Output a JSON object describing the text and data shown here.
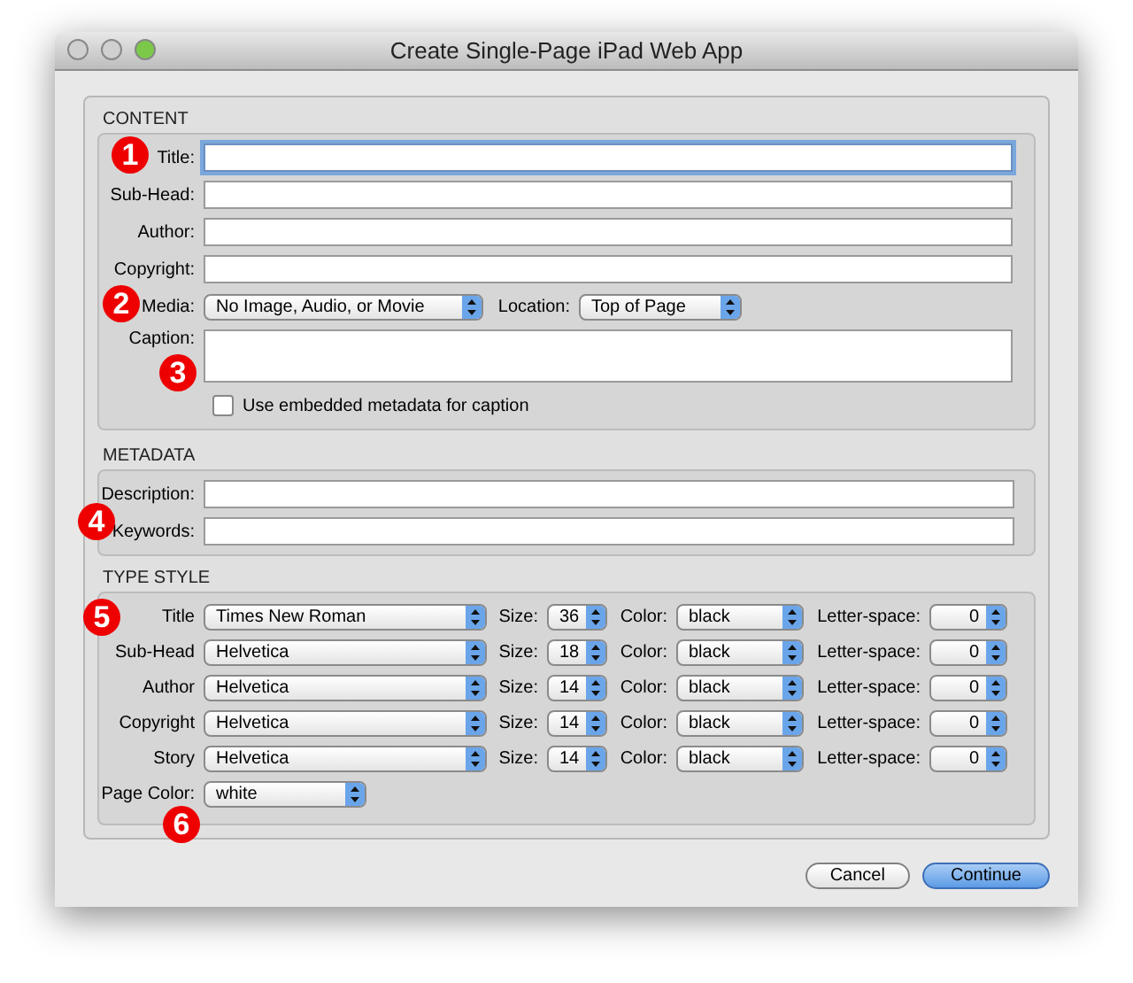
{
  "window": {
    "title": "Create Single-Page iPad Web App"
  },
  "content": {
    "heading": "CONTENT",
    "fields": [
      {
        "label": "Title:",
        "focused": true
      },
      {
        "label": "Sub-Head:",
        "focused": false
      },
      {
        "label": "Author:",
        "focused": false
      },
      {
        "label": "Copyright:",
        "focused": false
      }
    ],
    "media": {
      "label": "Media:",
      "value": "No Image, Audio, or Movie"
    },
    "location": {
      "label": "Location:",
      "value": "Top of Page"
    },
    "caption": {
      "label": "Caption:"
    },
    "metadata_checkbox": {
      "label": "Use embedded metadata for caption",
      "checked": false
    }
  },
  "metadata": {
    "heading": "METADATA",
    "fields": [
      {
        "label": "Description:"
      },
      {
        "label": "Keywords:"
      }
    ]
  },
  "type_style": {
    "heading": "TYPE STYLE",
    "rows": [
      {
        "element": "Title",
        "font": "Times New Roman",
        "size_label": "Size:",
        "size": "36",
        "color_label": "Color:",
        "text_color": "black",
        "spacing_label": "Letter-space:",
        "letter_space": "0"
      },
      {
        "element": "Sub-Head",
        "font": "Helvetica",
        "size_label": "Size:",
        "size": "18",
        "color_label": "Color:",
        "text_color": "black",
        "spacing_label": "Letter-space:",
        "letter_space": "0"
      },
      {
        "element": "Author",
        "font": "Helvetica",
        "size_label": "Size:",
        "size": "14",
        "color_label": "Color:",
        "text_color": "black",
        "spacing_label": "Letter-space:",
        "letter_space": "0"
      },
      {
        "element": "Copyright",
        "font": "Helvetica",
        "size_label": "Size:",
        "size": "14",
        "color_label": "Color:",
        "text_color": "black",
        "spacing_label": "Letter-space:",
        "letter_space": "0"
      },
      {
        "element": "Story",
        "font": "Helvetica",
        "size_label": "Size:",
        "size": "14",
        "color_label": "Color:",
        "text_color": "black",
        "spacing_label": "Letter-space:",
        "letter_space": "0"
      }
    ],
    "page_color": {
      "label": "Page Color:",
      "value": "white"
    }
  },
  "buttons": [
    {
      "label": "Cancel",
      "default": false
    },
    {
      "label": "Continue",
      "default": true
    }
  ],
  "badges": [
    "1",
    "2",
    "3",
    "4",
    "5",
    "6"
  ]
}
